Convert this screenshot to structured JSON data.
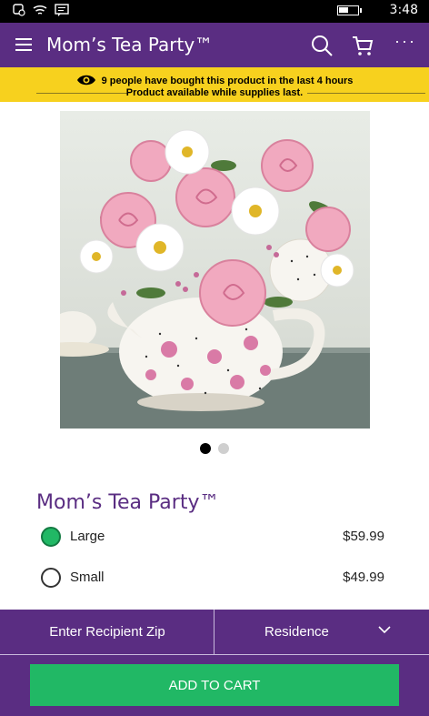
{
  "status_bar": {
    "time": "3:48",
    "battery_level": 0.55
  },
  "app_bar": {
    "title": "Mom’s Tea Party™",
    "more_label": "···"
  },
  "notice": {
    "line1": "9 people have bought this product in the last 4 hours",
    "line2": "Product available while supplies last."
  },
  "carousel": {
    "total": 2,
    "active_index": 0
  },
  "product": {
    "name": "Mom’s Tea Party™",
    "options": [
      {
        "label": "Large",
        "price": "$59.99",
        "selected": true
      },
      {
        "label": "Small",
        "price": "$49.99",
        "selected": false
      }
    ]
  },
  "delivery": {
    "zip_label": "Enter Recipient Zip",
    "address_type": "Residence"
  },
  "cart": {
    "add_label": "ADD TO CART"
  },
  "colors": {
    "brand": "#5a2d82",
    "accent": "#21b865",
    "notice": "#f7d11e"
  }
}
